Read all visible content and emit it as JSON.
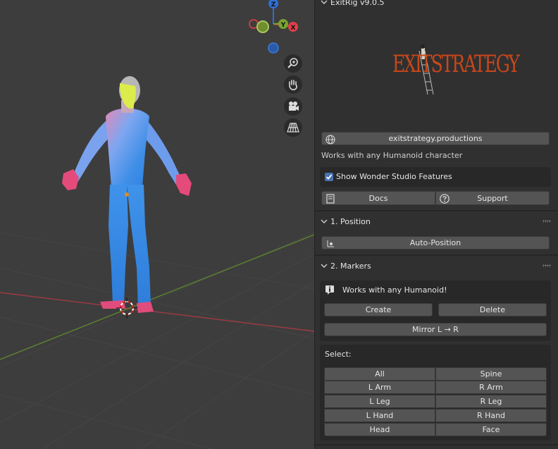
{
  "addon": {
    "title": "ExitRig v9.0.5",
    "logo_text": "EXITSTRATEGY"
  },
  "links": {
    "website": "exitstrategy.productions"
  },
  "tagline": "Works with any Humanoid character",
  "wonder_studio": {
    "label": "Show Wonder Studio Features",
    "checked": true
  },
  "help": {
    "docs_label": "Docs",
    "support_label": "Support"
  },
  "sections": {
    "position": {
      "title": "1. Position",
      "auto_position_label": "Auto-Position"
    },
    "markers": {
      "title": "2. Markers",
      "info": "Works with any Humanoid!",
      "create_label": "Create",
      "delete_label": "Delete",
      "mirror_label": "Mirror L → R",
      "select_label": "Select:",
      "select_buttons": [
        [
          "All",
          "Spine"
        ],
        [
          "L Arm",
          "R Arm"
        ],
        [
          "L Leg",
          "R Leg"
        ],
        [
          "L Hand",
          "R Hand"
        ],
        [
          "Head",
          "Face"
        ]
      ]
    }
  },
  "gizmo": {
    "z_label": "Z",
    "y_label": "Y",
    "x_label": "X"
  },
  "colors": {
    "accent": "#4772b3",
    "x_axis": "#e0404a",
    "y_axis": "#78a32f",
    "z_axis": "#2f6fd4",
    "logo": "#c8471a"
  }
}
